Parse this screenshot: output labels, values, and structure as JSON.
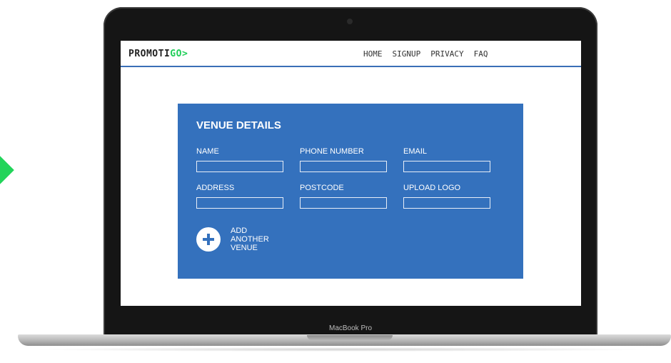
{
  "site": {
    "logo_main": "PROMOTI",
    "logo_accent": "GO",
    "logo_arrow": ">"
  },
  "nav": {
    "items": [
      {
        "label": "HOME"
      },
      {
        "label": "SIGNUP"
      },
      {
        "label": "PRIVACY"
      },
      {
        "label": "FAQ"
      }
    ]
  },
  "form": {
    "title": "VENUE DETAILS",
    "fields": [
      {
        "label": "NAME",
        "value": ""
      },
      {
        "label": "PHONE NUMBER",
        "value": ""
      },
      {
        "label": "EMAIL",
        "value": ""
      },
      {
        "label": "ADDRESS",
        "value": ""
      },
      {
        "label": "POSTCODE",
        "value": ""
      },
      {
        "label": "UPLOAD LOGO",
        "value": ""
      }
    ],
    "add_venue_label": "ADD ANOTHER VENUE",
    "add_icon": "plus-icon"
  },
  "device": {
    "label": "MacBook Pro"
  },
  "colors": {
    "accent": "#1fce58",
    "panel": "#3471bd",
    "header_rule": "#3a6fb7"
  }
}
